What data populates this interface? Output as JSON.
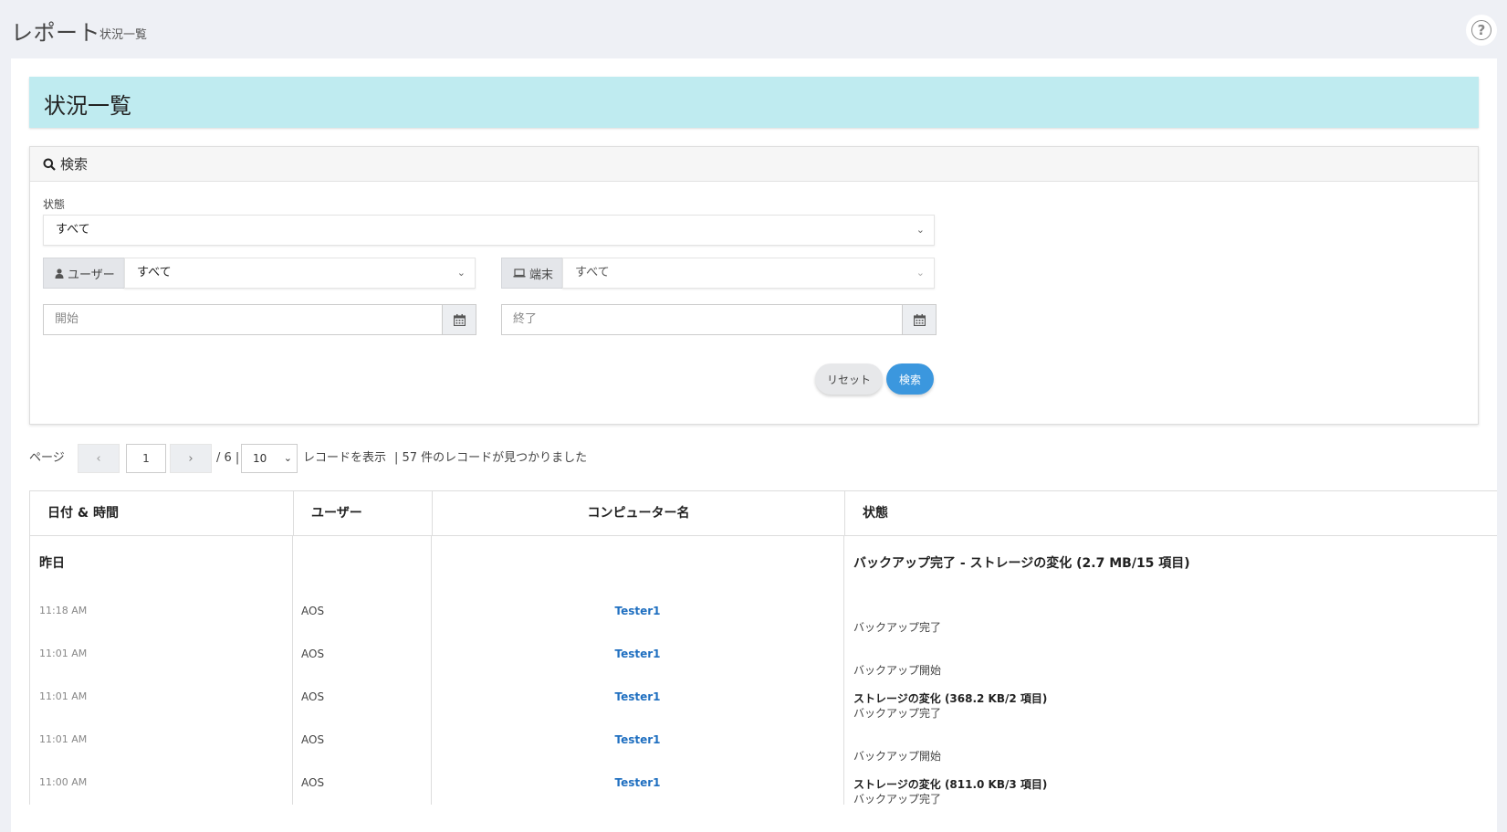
{
  "header": {
    "title": "レポート",
    "subtitle": "状況一覧",
    "help_symbol": "?"
  },
  "banner": {
    "title": "状況一覧"
  },
  "search": {
    "heading": "検索",
    "status_label": "状態",
    "status_value": "すべて",
    "user_label": "ユーザー",
    "user_value": "すべて",
    "device_label": "端末",
    "device_value": "すべて",
    "start_placeholder": "開始",
    "end_placeholder": "終了",
    "reset_label": "リセット",
    "search_label": "検索"
  },
  "pager": {
    "page_label": "ページ",
    "prev": "‹",
    "current_page": "1",
    "next": "›",
    "total_pages_text": "/ 6 |",
    "page_size": "10",
    "records_label": "レコードを表示",
    "found_text": "| 57 件のレコードが見つかりました"
  },
  "table": {
    "headers": [
      "日付 & 時間",
      "ユーザー",
      "コンピューター名",
      "状態"
    ],
    "group": {
      "date": "昨日",
      "summary": "バックアップ完了 - ストレージの変化 (2.7 MB/15 項目)"
    },
    "rows": [
      {
        "time": "11:18 AM",
        "user": "AOS",
        "computer": "Tester1",
        "status": "バックアップ完了",
        "detail": ""
      },
      {
        "time": "11:01 AM",
        "user": "AOS",
        "computer": "Tester1",
        "status": "バックアップ開始",
        "detail": ""
      },
      {
        "time": "11:01 AM",
        "user": "AOS",
        "computer": "Tester1",
        "status": "バックアップ完了",
        "detail": "ストレージの変化 (368.2 KB/2 項目)"
      },
      {
        "time": "11:01 AM",
        "user": "AOS",
        "computer": "Tester1",
        "status": "バックアップ開始",
        "detail": ""
      },
      {
        "time": "11:00 AM",
        "user": "AOS",
        "computer": "Tester1",
        "status": "バックアップ完了",
        "detail": "ストレージの変化 (811.0 KB/3 項目)"
      }
    ]
  }
}
